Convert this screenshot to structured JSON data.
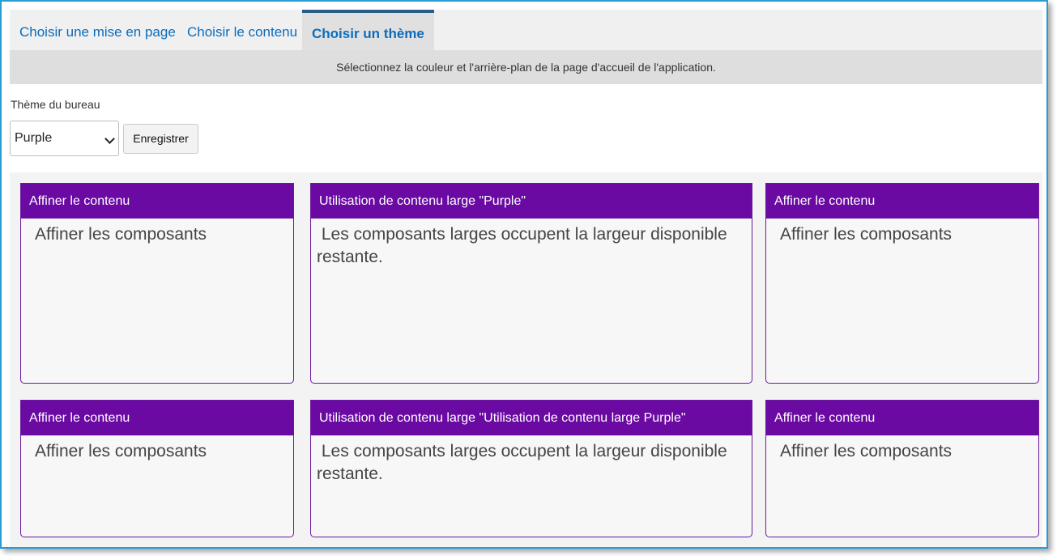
{
  "tabs": [
    {
      "label": "Choisir une mise en page",
      "active": false
    },
    {
      "label": "Choisir le contenu",
      "active": false
    },
    {
      "label": "Choisir un thème",
      "active": true
    }
  ],
  "banner": {
    "text": "Sélectionnez la couleur et l'arrière-plan de la page d'accueil de l'application."
  },
  "theme": {
    "label": "Thème du bureau",
    "selected": "Purple",
    "save_label": "Enregistrer"
  },
  "colors": {
    "accent": "#6a0aa3",
    "tab_text": "#0b6cbd",
    "frame_border": "#2b9bd4"
  },
  "cards": [
    {
      "header": "Affiner le contenu",
      "body": "Affiner les composants"
    },
    {
      "header": "Utilisation de contenu large \"Purple\"",
      "body": " Les composants larges occupent la largeur disponible restante."
    },
    {
      "header": "Affiner le contenu",
      "body": "Affiner les composants"
    },
    {
      "header": "Affiner le contenu",
      "body": "Affiner les composants"
    },
    {
      "header": "Utilisation de contenu large \"Utilisation de contenu large Purple\"",
      "body": " Les composants larges occupent la largeur disponible restante."
    },
    {
      "header": "Affiner le contenu",
      "body": "Affiner les composants"
    }
  ]
}
